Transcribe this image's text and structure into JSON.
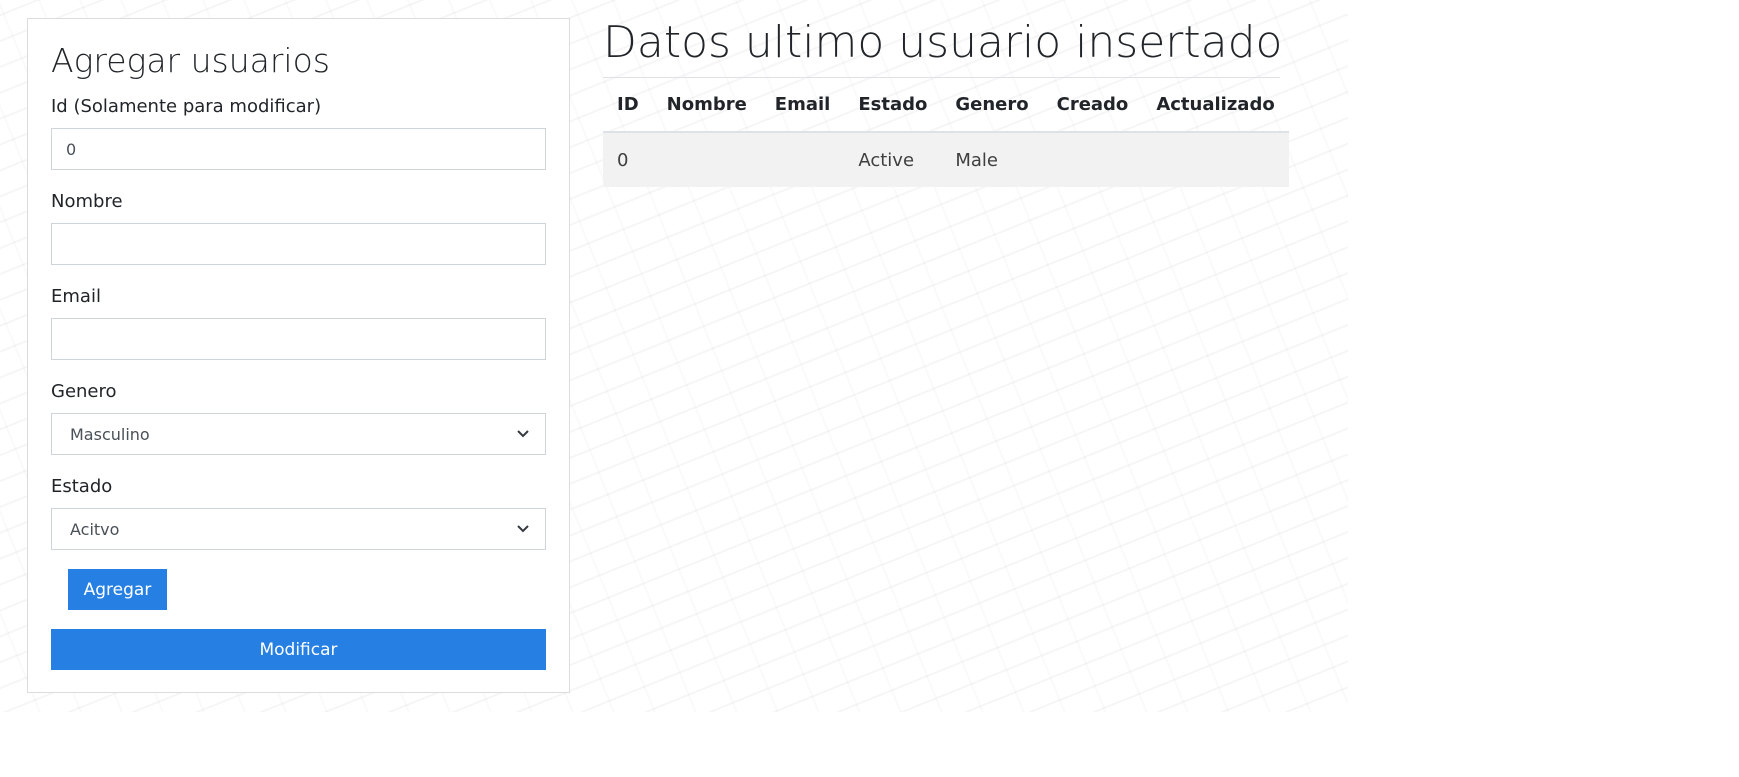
{
  "form": {
    "title": "Agregar usuarios",
    "id_label": "Id (Solamente para modificar)",
    "id_value": "0",
    "name_label": "Nombre",
    "name_value": "",
    "email_label": "Email",
    "email_value": "",
    "gender_label": "Genero",
    "gender_selected": "Masculino",
    "status_label": "Estado",
    "status_selected": "Acitvo",
    "add_button": "Agregar",
    "modify_button": "Modificar"
  },
  "table": {
    "title": "Datos ultimo usuario insertado",
    "columns": [
      "ID",
      "Nombre",
      "Email",
      "Estado",
      "Genero",
      "Creado",
      "Actualizado"
    ],
    "rows": [
      [
        "0",
        "",
        "",
        "Active",
        "Male",
        "",
        ""
      ]
    ]
  },
  "colors": {
    "accent": "#2680e3",
    "row_background": "#f2f2f2"
  },
  "icons": {
    "select_arrow": "chevron-down-icon"
  }
}
